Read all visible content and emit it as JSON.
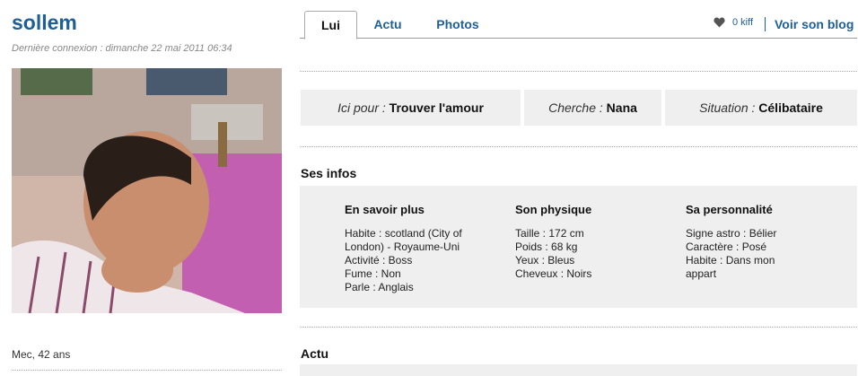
{
  "profile": {
    "username": "sollem",
    "last_login": "Dernière connexion : dimanche 22 mai 2011 06:34",
    "summary": "Mec, 42 ans",
    "photo": "profile-photo"
  },
  "tabs": [
    {
      "label": "Lui",
      "active": true
    },
    {
      "label": "Actu",
      "active": false
    },
    {
      "label": "Photos",
      "active": false
    }
  ],
  "header_actions": {
    "kiff_label": "0 kiff",
    "kiff_icon": "heart-icon",
    "blog_label": "Voir son blog"
  },
  "summary_bar": [
    {
      "key": "Ici pour :",
      "value": "Trouver l'amour"
    },
    {
      "key": "Cherche :",
      "value": "Nana"
    },
    {
      "key": "Situation :",
      "value": "Célibataire"
    }
  ],
  "infos": {
    "title": "Ses infos",
    "columns": [
      {
        "title": "En savoir plus",
        "lines": [
          "Habite : scotland (City of",
          "London) - Royaume-Uni",
          "Activité : Boss",
          "Fume : Non",
          "Parle : Anglais"
        ]
      },
      {
        "title": "Son physique",
        "lines": [
          "Taille : 172 cm",
          "Poids : 68 kg",
          "Yeux : Bleus",
          "Cheveux : Noirs"
        ]
      },
      {
        "title": "Sa personnalité",
        "lines": [
          "Signe astro : Bélier",
          "Caractère : Posé",
          "Habite : Dans mon",
          "appart"
        ]
      }
    ]
  },
  "actu": {
    "title": "Actu"
  },
  "colors": {
    "link": "#1d5f96",
    "panel": "#efefef"
  }
}
